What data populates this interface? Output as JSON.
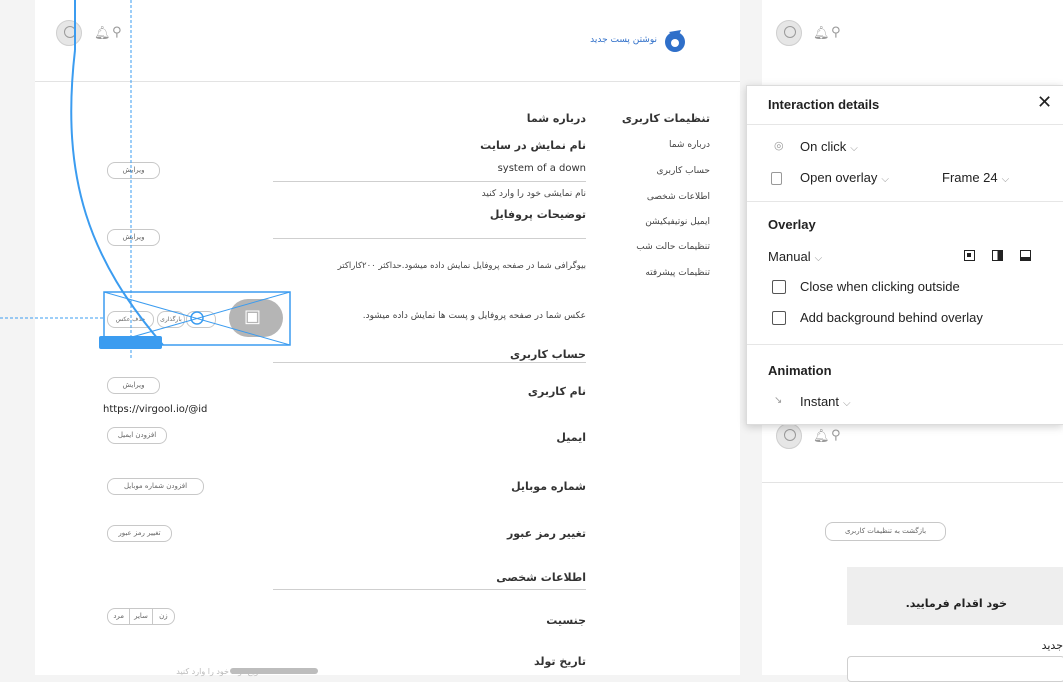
{
  "header": {
    "logo_text": "نوشتن پست جدید"
  },
  "sidebar": {
    "title": "تنظیمات کاربری",
    "items": [
      "درباره شما",
      "حساب کاربری",
      "اطلاعات شخصی",
      "ایمیل نوتیفیکیشن",
      "تنظیمات حالت شب",
      "تنظیمات پیشرفته"
    ]
  },
  "about": {
    "section_title": "درباره شما",
    "display_name_label": "نام نمایش در سایت",
    "display_name_value": "system of a down",
    "display_name_help": "نام نمایشی خود را وارد کنید",
    "profile_desc_label": "توضیحات پروفایل",
    "bio_help": "بیوگرافی شما در صفحه پروفایل نمایش داده میشود.حداکثر ۲۰۰کاراکتر",
    "photo_help": "عکس شما در صفحه پروفایل و پست ها نمایش داده میشود.",
    "edit_label": "ویرایش",
    "upload_left": "حذف عکس",
    "upload_mid": "بارگذاری"
  },
  "account": {
    "section_title": "حساب کاربری",
    "username_label": "نام کاربری",
    "username_value": "https://virgool.io/@id",
    "edit_label": "ویرایش",
    "email_label": "ایمیل",
    "add_email": "افزودن ایمیل",
    "mobile_label": "شماره موبایل",
    "add_mobile": "افزودن شماره موبایل",
    "password_label": "تغییر رمز عبور",
    "change_password": "تغییر رمز عبور"
  },
  "personal": {
    "section_title": "اطلاعات شخصی",
    "gender_label": "جنسیت",
    "gender_options": [
      "زن",
      "سایر",
      "مرد"
    ],
    "birthdate_label": "تاریخ تولد",
    "birthdate_help": "تاریخ تولد خود را وارد کنید"
  },
  "right_frame": {
    "back_button": "بازگشت به تنظیمات کاربری",
    "notice_text": "خود اقدام فرمایید.",
    "new_label": "جدید"
  },
  "panel": {
    "title": "Interaction details",
    "close_icon": "close-icon",
    "trigger": "On click",
    "action": "Open overlay",
    "destination": "Frame 24",
    "overlay_title": "Overlay",
    "position": "Manual",
    "close_outside": "Close when clicking outside",
    "add_background": "Add background behind overlay",
    "animation_title": "Animation",
    "animation": "Instant"
  },
  "colors": {
    "accent": "#3b9cf0",
    "logo": "#2f6fc9"
  }
}
